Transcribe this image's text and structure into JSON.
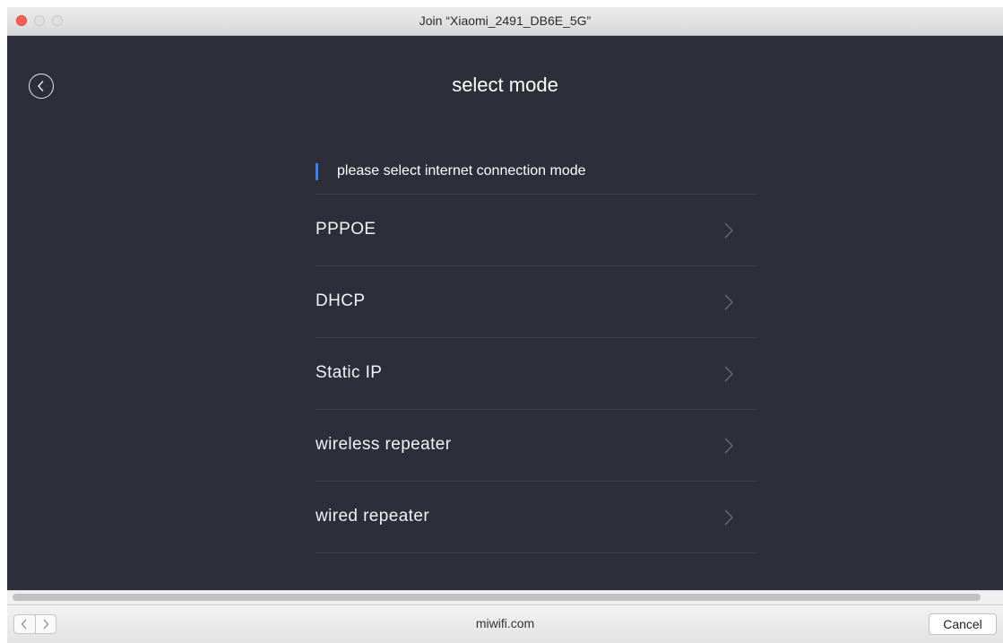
{
  "window": {
    "title": "Join “Xiaomi_2491_DB6E_5G”"
  },
  "page": {
    "title": "select mode",
    "section_header": "please select internet connection mode"
  },
  "modes": [
    {
      "label": "PPPOE"
    },
    {
      "label": "DHCP"
    },
    {
      "label": "Static IP"
    },
    {
      "label": "wireless repeater"
    },
    {
      "label": "wired repeater"
    }
  ],
  "bottom_bar": {
    "url": "miwifi.com",
    "cancel_label": "Cancel"
  },
  "colors": {
    "background": "#2c2f3a",
    "accent": "#3a7ff2",
    "divider": "#3d404b",
    "text": "#f2f2f2"
  },
  "icons": {
    "back": "circle-chevron-left-icon",
    "row": "chevron-right-icon",
    "nav_back": "chevron-left-icon",
    "nav_forward": "chevron-right-icon"
  }
}
